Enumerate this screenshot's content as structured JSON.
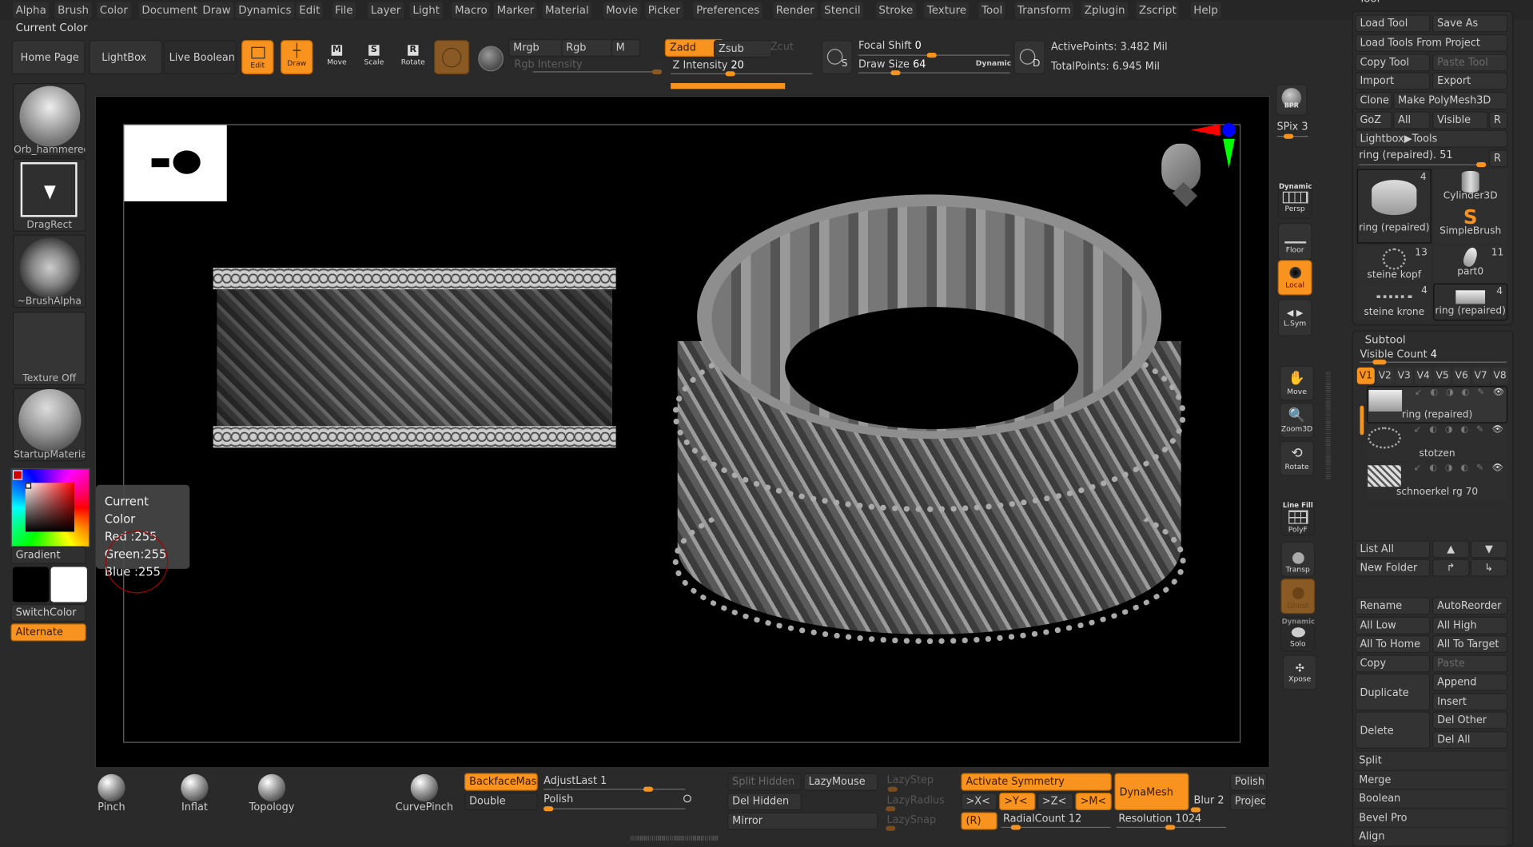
{
  "menu": [
    "Alpha",
    "Brush",
    "Color",
    "Document",
    "Draw",
    "Dynamics",
    "Edit",
    "File",
    "Layer",
    "Light",
    "Macro",
    "Marker",
    "Material",
    "Movie",
    "Picker",
    "Preferences",
    "Render",
    "Stencil",
    "Stroke",
    "Texture",
    "Tool",
    "Transform",
    "Zplugin",
    "Zscript",
    "Help"
  ],
  "status_label": "Current Color",
  "top_shelf": {
    "home_page": "Home Page",
    "lightbox": "LightBox",
    "live_boolean": "Live Boolean",
    "edit": "Edit",
    "draw": "Draw",
    "move": "Move",
    "scale": "Scale",
    "rotate": "Rotate",
    "mrgb": "Mrgb",
    "rgb": "Rgb",
    "m": "M",
    "rgb_intensity": "Rgb Intensity",
    "zadd": "Zadd",
    "zsub": "Zsub",
    "zcut": "Zcut",
    "z_intensity_label": "Z Intensity",
    "z_intensity_value": "20",
    "focal_shift_label": "Focal Shift",
    "focal_shift_value": "0",
    "draw_size_label": "Draw Size",
    "draw_size_value": "64",
    "dynamic": "Dynamic",
    "active_points": "ActivePoints: 3.482 Mil",
    "total_points": "TotalPoints: 6.945 Mil",
    "s_label": "S",
    "d_label": "D"
  },
  "left_shelf": {
    "material_name": "Orb_hammeredM",
    "stroke_name": "DragRect",
    "alpha_name": "~BrushAlpha",
    "texture_name": "Texture Off",
    "material2_name": "StartupMaterial",
    "gradient": "Gradient",
    "switch_color": "SwitchColor",
    "alternate": "Alternate"
  },
  "tooltip": {
    "title": "Current Color",
    "red": "Red  :255",
    "green": "Green:255",
    "blue": "Blue :255"
  },
  "right_shelf": {
    "bpr": "BPR",
    "spix": "SPix 3",
    "dynamic": "Dynamic",
    "persp": "Persp",
    "floor": "Floor",
    "local": "Local",
    "lsym": "L.Sym",
    "move": "Move",
    "zoom3d": "Zoom3D",
    "rotate": "Rotate",
    "line_fill": "Line Fill",
    "polyf": "PolyF",
    "transp": "Transp",
    "ghost": "Ghost",
    "solo_dynamic": "Dynamic",
    "solo": "Solo",
    "xpose": "Xpose"
  },
  "tool_panel": {
    "title": "Tool",
    "load_tool": "Load Tool",
    "save_as": "Save As",
    "load_from_project": "Load Tools From Project",
    "copy_tool": "Copy Tool",
    "paste_tool": "Paste Tool",
    "import": "Import",
    "export": "Export",
    "clone": "Clone",
    "make_polymesh": "Make PolyMesh3D",
    "goz": "GoZ",
    "all": "All",
    "visible": "Visible",
    "r": "R",
    "lightbox_tools": "Lightbox▶Tools",
    "current_tool": "ring (repaired). 51",
    "tools": [
      {
        "name": "ring (repaired)",
        "count": "4"
      },
      {
        "name": "Cylinder3D",
        "count": ""
      },
      {
        "name": "SimpleBrush",
        "count": ""
      },
      {
        "name": "steine kopf",
        "count": "13"
      },
      {
        "name": "part0",
        "count": "11"
      },
      {
        "name": "steine krone",
        "count": "4"
      },
      {
        "name": "ring (repaired)",
        "count": "4"
      }
    ]
  },
  "subtool": {
    "title": "Subtool",
    "visible_count_label": "Visible Count",
    "visible_count_value": "4",
    "visible_count_fraction": 0.12,
    "vsets": [
      "V1",
      "V2",
      "V3",
      "V4",
      "V5",
      "V6",
      "V7",
      "V8"
    ],
    "items": [
      "ring (repaired)",
      "stotzen",
      "schnoerkel rg 70"
    ],
    "list_all": "List All",
    "new_folder": "New Folder",
    "rename": "Rename",
    "auto_reorder": "AutoReorder",
    "all_low": "All Low",
    "all_high": "All High",
    "all_to_home": "All To Home",
    "all_to_target": "All To Target",
    "copy": "Copy",
    "paste": "Paste",
    "duplicate": "Duplicate",
    "append": "Append",
    "insert": "Insert",
    "delete": "Delete",
    "del_other": "Del Other",
    "del_all": "Del All",
    "sections": [
      "Split",
      "Merge",
      "Boolean",
      "Bevel Pro",
      "Align"
    ]
  },
  "bottom_shelf": {
    "brushes": [
      "Pinch",
      "Inflat",
      "Topology",
      "CurvePinch"
    ],
    "backface_mask": "BackfaceMask",
    "double": "Double",
    "adjust_last": "AdjustLast 1",
    "polish": "Polish",
    "split_hidden": "Split Hidden",
    "lazy_mouse": "LazyMouse",
    "del_hidden": "Del Hidden",
    "mirror": "Mirror",
    "lazy_step": "LazyStep",
    "lazy_radius": "LazyRadius",
    "lazy_snap": "LazySnap",
    "activate_symmetry": "Activate Symmetry",
    "x_axis": ">X<",
    "y_axis": ">Y<",
    "z_axis": ">Z<",
    "m_axis": ">M<",
    "radial": "(R)",
    "radial_count": "RadialCount 12",
    "dynamesh": "DynaMesh",
    "blur": "Blur 2",
    "resolution": "Resolution 1024",
    "polish_btn": "Polish",
    "project": "Project"
  },
  "colors": {
    "accent": "#f7931e",
    "background": "#2a2a2a",
    "canvas": "#000000"
  }
}
